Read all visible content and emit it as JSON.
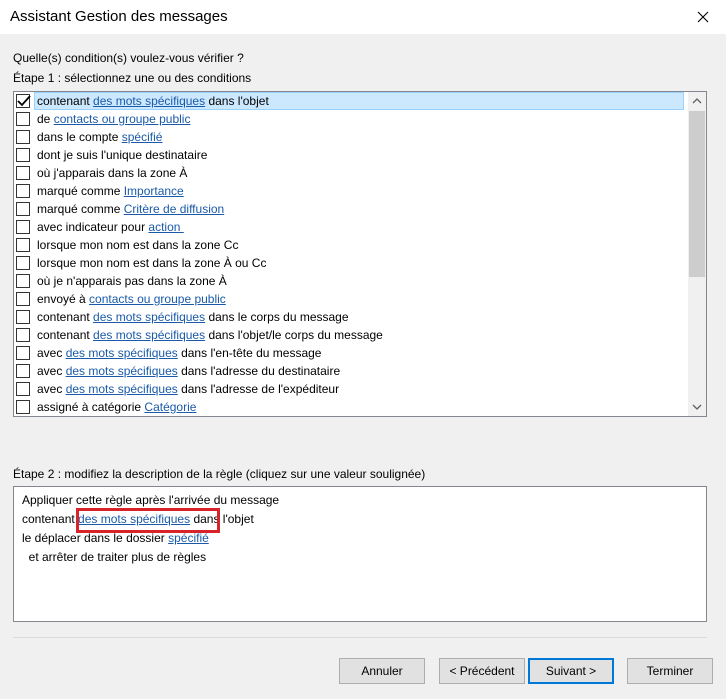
{
  "window": {
    "title": "Assistant Gestion des messages"
  },
  "question": "Quelle(s) condition(s) voulez-vous vérifier ?",
  "step1_label": "Étape 1 : sélectionnez une ou des conditions",
  "conditions": [
    {
      "checked": true,
      "selected": true,
      "parts": [
        {
          "t": "contenant "
        },
        {
          "t": "des mots spécifiques",
          "link": true
        },
        {
          "t": " dans l'objet"
        }
      ]
    },
    {
      "checked": false,
      "parts": [
        {
          "t": "de "
        },
        {
          "t": "contacts ou groupe public",
          "link": true
        }
      ]
    },
    {
      "checked": false,
      "parts": [
        {
          "t": "dans le compte "
        },
        {
          "t": "spécifié",
          "link": true
        }
      ]
    },
    {
      "checked": false,
      "parts": [
        {
          "t": "dont je suis l'unique destinataire"
        }
      ]
    },
    {
      "checked": false,
      "parts": [
        {
          "t": "où j'apparais dans la zone À"
        }
      ]
    },
    {
      "checked": false,
      "parts": [
        {
          "t": "marqué comme "
        },
        {
          "t": "Importance",
          "link": true
        }
      ]
    },
    {
      "checked": false,
      "parts": [
        {
          "t": "marqué comme "
        },
        {
          "t": "Critère de diffusion",
          "link": true
        }
      ]
    },
    {
      "checked": false,
      "parts": [
        {
          "t": "avec indicateur pour "
        },
        {
          "t": "action ",
          "link": true
        }
      ]
    },
    {
      "checked": false,
      "parts": [
        {
          "t": "lorsque mon nom est dans la zone Cc"
        }
      ]
    },
    {
      "checked": false,
      "parts": [
        {
          "t": "lorsque mon nom est dans la zone À ou Cc"
        }
      ]
    },
    {
      "checked": false,
      "parts": [
        {
          "t": "où je n'apparais pas dans la zone À"
        }
      ]
    },
    {
      "checked": false,
      "parts": [
        {
          "t": "envoyé à "
        },
        {
          "t": "contacts ou groupe public",
          "link": true
        }
      ]
    },
    {
      "checked": false,
      "parts": [
        {
          "t": "contenant "
        },
        {
          "t": "des mots spécifiques",
          "link": true
        },
        {
          "t": " dans le corps du message"
        }
      ]
    },
    {
      "checked": false,
      "parts": [
        {
          "t": "contenant "
        },
        {
          "t": "des mots spécifiques",
          "link": true
        },
        {
          "t": " dans l'objet/le corps du message"
        }
      ]
    },
    {
      "checked": false,
      "parts": [
        {
          "t": "avec "
        },
        {
          "t": "des mots spécifiques",
          "link": true
        },
        {
          "t": " dans l'en-tête du message"
        }
      ]
    },
    {
      "checked": false,
      "parts": [
        {
          "t": "avec "
        },
        {
          "t": "des mots spécifiques",
          "link": true
        },
        {
          "t": " dans l'adresse du destinataire"
        }
      ]
    },
    {
      "checked": false,
      "parts": [
        {
          "t": "avec "
        },
        {
          "t": "des mots spécifiques",
          "link": true
        },
        {
          "t": " dans l'adresse de l'expéditeur"
        }
      ]
    },
    {
      "checked": false,
      "parts": [
        {
          "t": "assigné à catégorie "
        },
        {
          "t": "Catégorie",
          "link": true
        }
      ]
    }
  ],
  "step2_label": "Étape 2 : modifiez la description de la règle (cliquez sur une valeur soulignée)",
  "description": {
    "line1": "Appliquer cette règle après l'arrivée du message",
    "line2_prefix": "contenant ",
    "line2_link": "des mots spécifiques",
    "line2_suffix": " dans l'objet",
    "line3_prefix": "le déplacer dans le dossier ",
    "line3_link": "spécifié",
    "line4": "  et arrêter de traiter plus de règles"
  },
  "buttons": {
    "cancel": "Annuler",
    "previous": "< Précédent",
    "next": "Suivant >",
    "finish": "Terminer"
  },
  "colors": {
    "link": "#1a5aa8",
    "highlight": "#d8232a",
    "selection": "#cce8ff"
  }
}
